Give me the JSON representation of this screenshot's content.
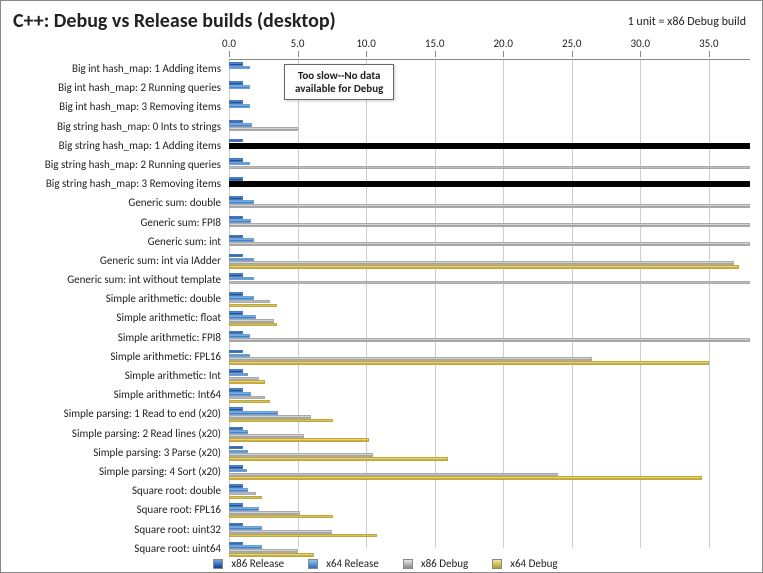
{
  "chart_data": {
    "type": "bar",
    "title": "C++: Debug vs Release builds (desktop)",
    "unit_note": "1 unit = x86 Debug build",
    "xlabel": "",
    "ylabel": "",
    "xlim": [
      0,
      38
    ],
    "ticks": [
      0.0,
      5.0,
      10.0,
      15.0,
      20.0,
      25.0,
      30.0,
      35.0
    ],
    "series": [
      {
        "name": "x86 Release"
      },
      {
        "name": "x64 Release"
      },
      {
        "name": "x86 Debug"
      },
      {
        "name": "x64 Debug"
      }
    ],
    "annotation": {
      "text_line1": "Too slow--No data",
      "text_line2": "available for Debug"
    },
    "categories": [
      {
        "label": "Big int hash_map: 1 Adding items",
        "values": [
          1.0,
          1.5,
          null,
          null
        ]
      },
      {
        "label": "Big int hash_map: 2 Running queries",
        "values": [
          1.0,
          1.5,
          null,
          null
        ]
      },
      {
        "label": "Big int hash_map: 3 Removing items",
        "values": [
          1.0,
          1.5,
          null,
          null
        ]
      },
      {
        "label": "Big string hash_map: 0 Ints to strings",
        "values": [
          1.0,
          1.7,
          5.0,
          null
        ]
      },
      {
        "label": "Big string hash_map: 1 Adding items",
        "values": [
          1.0,
          1.7,
          null,
          null
        ],
        "overflow": true
      },
      {
        "label": "Big string hash_map: 2 Running queries",
        "values": [
          1.0,
          1.5,
          38.0,
          null
        ],
        "clip": true
      },
      {
        "label": "Big string hash_map: 3 Removing items",
        "values": [
          1.0,
          1.7,
          null,
          null
        ],
        "overflow": true
      },
      {
        "label": "Generic sum: double",
        "values": [
          1.0,
          1.8,
          38.0,
          null
        ],
        "clip": true
      },
      {
        "label": "Generic sum: FPI8",
        "values": [
          1.0,
          1.6,
          38.0,
          null
        ],
        "clip": true
      },
      {
        "label": "Generic sum: int",
        "values": [
          1.0,
          1.8,
          38.0,
          null
        ],
        "clip": true
      },
      {
        "label": "Generic sum: int via IAdder",
        "values": [
          1.0,
          1.8,
          36.8,
          37.2
        ]
      },
      {
        "label": "Generic sum: int without template",
        "values": [
          1.0,
          1.8,
          38.0,
          null
        ],
        "clip": true
      },
      {
        "label": "Simple arithmetic: double",
        "values": [
          1.0,
          1.8,
          3.0,
          3.5
        ]
      },
      {
        "label": "Simple arithmetic: float",
        "values": [
          1.0,
          2.0,
          3.3,
          3.5
        ]
      },
      {
        "label": "Simple arithmetic: FPI8",
        "values": [
          1.0,
          1.5,
          38.0,
          null
        ],
        "clip": true
      },
      {
        "label": "Simple arithmetic: FPL16",
        "values": [
          1.0,
          1.5,
          26.5,
          35.0
        ]
      },
      {
        "label": "Simple arithmetic: Int",
        "values": [
          1.0,
          1.4,
          2.2,
          2.6
        ]
      },
      {
        "label": "Simple arithmetic: Int64",
        "values": [
          1.0,
          1.6,
          2.6,
          3.0
        ]
      },
      {
        "label": "Simple parsing: 1 Read to end (x20)",
        "values": [
          1.0,
          3.6,
          6.0,
          7.6
        ]
      },
      {
        "label": "Simple parsing: 2 Read lines (x20)",
        "values": [
          1.0,
          1.4,
          5.5,
          10.2
        ]
      },
      {
        "label": "Simple parsing: 3 Parse (x20)",
        "values": [
          1.0,
          1.4,
          10.5,
          16.0
        ]
      },
      {
        "label": "Simple parsing: 4 Sort (x20)",
        "values": [
          1.0,
          1.3,
          24.0,
          34.5
        ]
      },
      {
        "label": "Square root: double",
        "values": [
          1.0,
          1.4,
          2.0,
          2.4
        ]
      },
      {
        "label": "Square root: FPL16",
        "values": [
          1.0,
          2.2,
          5.2,
          7.6
        ]
      },
      {
        "label": "Square root: uint32",
        "values": [
          1.0,
          2.4,
          7.5,
          10.8
        ]
      },
      {
        "label": "Square root: uint64",
        "values": [
          1.0,
          2.4,
          5.0,
          6.2
        ]
      }
    ]
  }
}
